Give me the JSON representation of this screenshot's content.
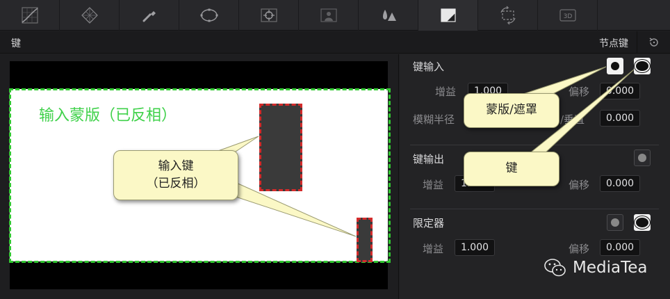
{
  "toolbar": {
    "tools": [
      {
        "icon": "curves-icon"
      },
      {
        "icon": "color-warper-icon"
      },
      {
        "icon": "qualifier-icon"
      },
      {
        "icon": "window-icon"
      },
      {
        "icon": "tracker-icon"
      },
      {
        "icon": "magic-mask-icon"
      },
      {
        "icon": "blur-icon"
      },
      {
        "icon": "key-icon",
        "active": true
      },
      {
        "icon": "sizing-icon"
      },
      {
        "icon": "3d-icon"
      }
    ]
  },
  "header": {
    "title": "键",
    "node_key": "节点键"
  },
  "viewer": {
    "mask_label": "输入蒙版（已反相）"
  },
  "panel": {
    "key_input": {
      "title": "键输入",
      "gain_label": "增益",
      "gain_value": "1.000",
      "offset_label": "偏移",
      "offset_value": "0.000",
      "blur_radius_label": "模糊半径",
      "blur_hv_label": "/垂直",
      "blur_hv_value": "0.000"
    },
    "key_output": {
      "title": "键输出",
      "gain_label": "增益",
      "gain_value": "1.000",
      "offset_label": "偏移",
      "offset_value": "0.000"
    },
    "qualifier": {
      "title": "限定器",
      "gain_label": "增益",
      "gain_value": "1.000",
      "offset_label": "偏移",
      "offset_value": "0.000"
    }
  },
  "callouts": {
    "input_key_line1": "输入键",
    "input_key_line2": "（已反相）",
    "mask_matte": "蒙版/遮罩",
    "key": "键"
  },
  "watermark": {
    "text": "MediaTea"
  },
  "colors": {
    "background": "#1f1f21",
    "mask_green": "#32c832",
    "key_red": "#d42b2b",
    "callout_fill": "#fbf8c6"
  }
}
